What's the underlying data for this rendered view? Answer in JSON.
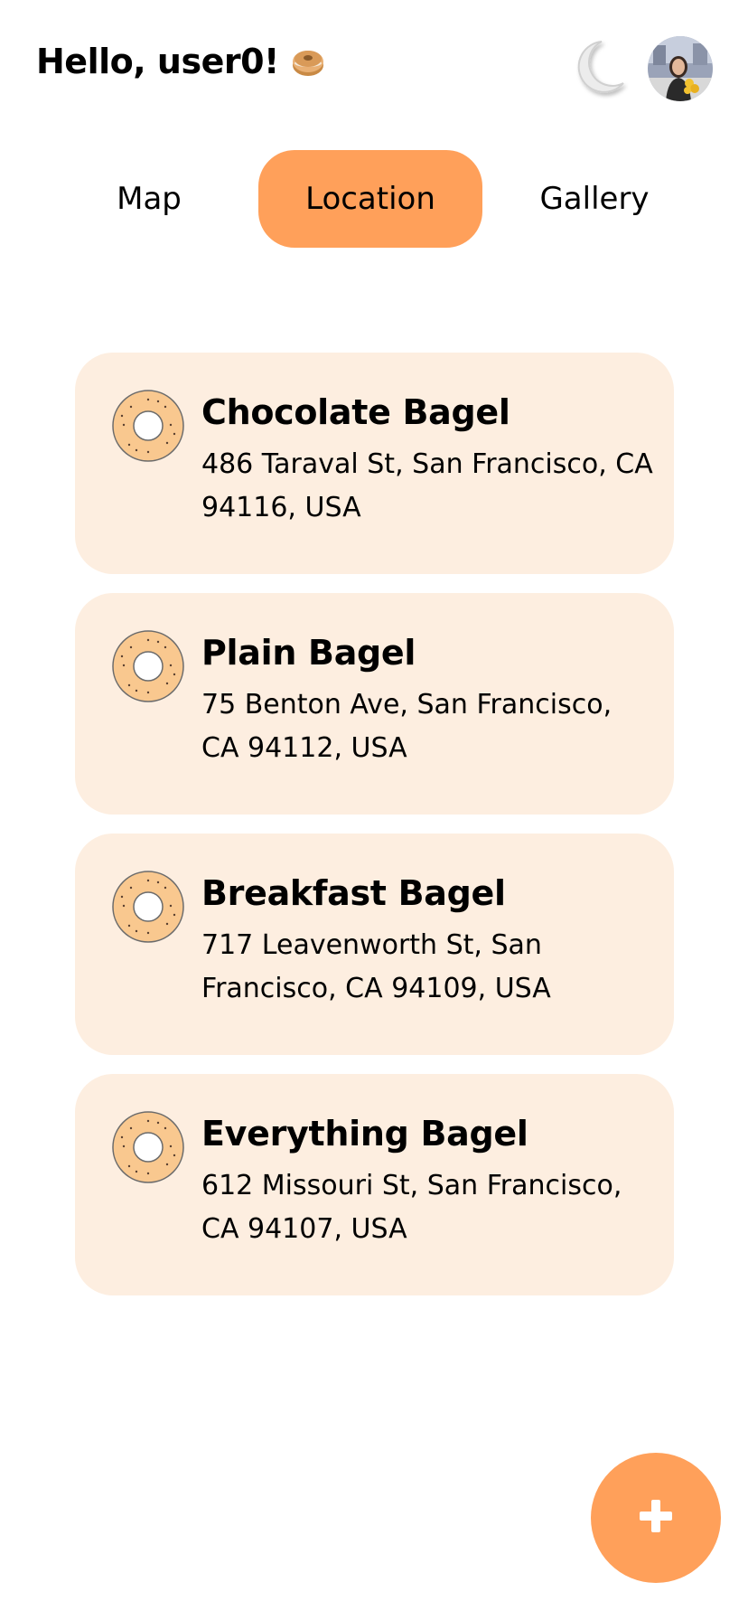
{
  "header": {
    "greeting": "Hello, user0!",
    "emoji_icon": "bagel-emoji-icon",
    "theme_icon": "moon-icon",
    "avatar_icon": "avatar"
  },
  "tabs": [
    {
      "label": "Map",
      "active": false
    },
    {
      "label": "Location",
      "active": true
    },
    {
      "label": "Gallery",
      "active": false
    }
  ],
  "locations": [
    {
      "name": "Chocolate Bagel",
      "address": "486 Taraval St, San Francisco, CA 94116, USA"
    },
    {
      "name": "Plain Bagel",
      "address": "75 Benton Ave, San Francisco, CA 94112, USA"
    },
    {
      "name": "Breakfast Bagel",
      "address": "717 Leavenworth St, San Francisco, CA 94109, USA"
    },
    {
      "name": "Everything Bagel",
      "address": "612 Missouri St, San Francisco, CA 94107, USA"
    }
  ],
  "fab": {
    "label": "+",
    "icon": "plus-icon"
  },
  "colors": {
    "accent": "#FFA05A",
    "card_background": "#FDEEE0",
    "bagel_fill": "#F9C88F"
  }
}
